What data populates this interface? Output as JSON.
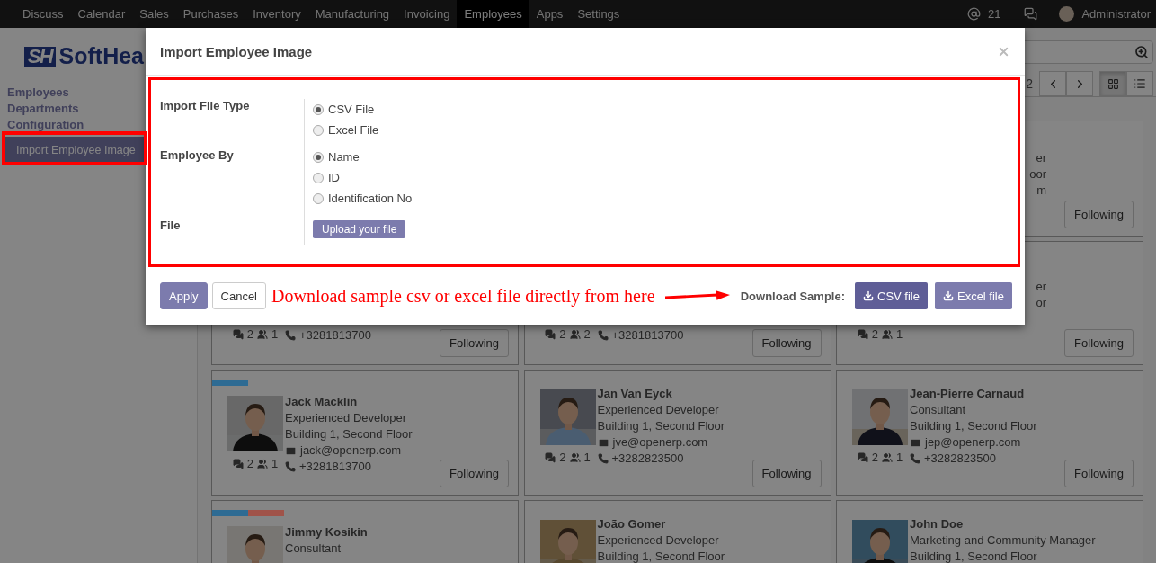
{
  "nav": {
    "items": [
      {
        "label": "Discuss",
        "selected": false
      },
      {
        "label": "Calendar",
        "selected": false
      },
      {
        "label": "Sales",
        "selected": false
      },
      {
        "label": "Purchases",
        "selected": false
      },
      {
        "label": "Inventory",
        "selected": false
      },
      {
        "label": "Manufacturing",
        "selected": false
      },
      {
        "label": "Invoicing",
        "selected": false
      },
      {
        "label": "Employees",
        "selected": true
      },
      {
        "label": "Apps",
        "selected": false
      },
      {
        "label": "Settings",
        "selected": false
      }
    ],
    "mentions": "21",
    "user": "Administrator"
  },
  "sidebar": {
    "logo": {
      "mark": "SH",
      "text": "SoftHea"
    },
    "items": [
      {
        "label": "Employees",
        "selected": false
      },
      {
        "label": "Departments",
        "selected": false
      },
      {
        "label": "Configuration",
        "selected": false
      },
      {
        "label": "Import Employee Image",
        "selected": true
      }
    ]
  },
  "control_panel": {
    "pager": "2",
    "views": [
      {
        "kind": "kanban",
        "selected": true
      },
      {
        "kind": "list",
        "selected": false
      }
    ]
  },
  "cards": [
    {
      "kind": "cut",
      "job": "er",
      "location": "oor",
      "email": "m",
      "button": "Following"
    },
    {
      "kind": "full",
      "messages": "2",
      "followers": "1",
      "phone": "+3281813700",
      "button": "Following"
    },
    {
      "kind": "full",
      "messages": "2",
      "followers": "2",
      "phone": "+3281813700",
      "button": "Following"
    },
    {
      "kind": "cut",
      "job": "er",
      "location": "or",
      "messages": "2",
      "followers": "1",
      "button": "Following"
    },
    {
      "kind": "full",
      "photo": true,
      "tags": [
        {
          "color": "#2e6b93"
        }
      ],
      "name": "Jack Macklin",
      "job": "Experienced Developer",
      "location": "Building 1, Second Floor",
      "email": "jack@openerp.com",
      "phone": "+3281813700",
      "messages": "2",
      "followers": "1",
      "button": "Following"
    },
    {
      "kind": "full",
      "photo": true,
      "name": "Jan Van Eyck",
      "job": "Experienced Developer",
      "location": "Building 1, Second Floor",
      "email": "jve@openerp.com",
      "phone": "+3282823500",
      "messages": "2",
      "followers": "1",
      "button": "Following"
    },
    {
      "kind": "full",
      "photo": true,
      "name": "Jean-Pierre Carnaud",
      "job": "Consultant",
      "location": "Building 1, Second Floor",
      "email": "jep@openerp.com",
      "phone": "+3282823500",
      "messages": "2",
      "followers": "1",
      "button": "Following"
    },
    {
      "kind": "full",
      "photo": true,
      "tags": [
        {
          "color": "#2e6b93"
        },
        {
          "color": "#a05349"
        }
      ],
      "name": "Jimmy Kosikin",
      "job": "Consultant"
    },
    {
      "kind": "full",
      "photo": true,
      "name": "João Gomer",
      "job": "Experienced Developer",
      "location": "Building 1, Second Floor"
    },
    {
      "kind": "full",
      "photo": true,
      "name": "John Doe",
      "job": "Marketing and Community Manager",
      "location": "Building 1, Second Floor"
    }
  ],
  "dialog": {
    "title": "Import Employee Image",
    "fields": [
      {
        "label": "Import File Type",
        "kind": "radio",
        "options": [
          {
            "label": "CSV File",
            "selected": true
          },
          {
            "label": "Excel File",
            "selected": false
          }
        ]
      },
      {
        "label": "Employee By",
        "kind": "radio",
        "options": [
          {
            "label": "Name",
            "selected": true
          },
          {
            "label": "ID",
            "selected": false
          },
          {
            "label": "Identification No",
            "selected": false
          }
        ]
      },
      {
        "label": "File",
        "kind": "upload",
        "button": "Upload your file"
      }
    ],
    "buttons": [
      {
        "label": "Apply",
        "kind": "primary"
      },
      {
        "label": "Cancel",
        "kind": "secondary"
      }
    ],
    "note": "Download sample csv or excel file directly from here",
    "download_label": "Download Sample:",
    "downloads": [
      {
        "label": "CSV file",
        "kind": "dark"
      },
      {
        "label": "Excel file",
        "kind": "light"
      }
    ]
  }
}
